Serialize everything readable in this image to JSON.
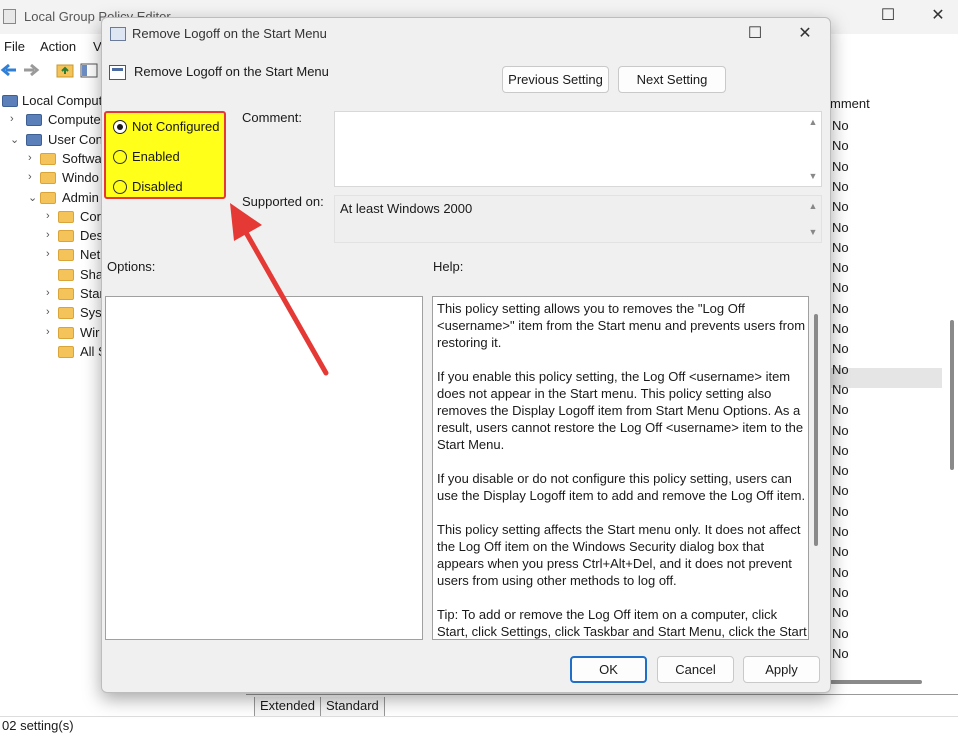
{
  "main": {
    "title": "Local Group Policy Editor",
    "menu": [
      "File",
      "Action",
      "V"
    ],
    "tree": [
      {
        "label": "Local Computer",
        "indent": 0,
        "chev": ""
      },
      {
        "label": "Computer",
        "indent": 1,
        "chev": "›"
      },
      {
        "label": "User Confi",
        "indent": 1,
        "chev": "⌄"
      },
      {
        "label": "Softwa",
        "indent": 2,
        "chev": "›"
      },
      {
        "label": "Windo",
        "indent": 2,
        "chev": "›"
      },
      {
        "label": "Admin",
        "indent": 2,
        "chev": "⌄"
      },
      {
        "label": "Cor",
        "indent": 3,
        "chev": "›"
      },
      {
        "label": "Des",
        "indent": 3,
        "chev": "›"
      },
      {
        "label": "Net",
        "indent": 3,
        "chev": "›"
      },
      {
        "label": "Sha",
        "indent": 3,
        "chev": ""
      },
      {
        "label": "Star",
        "indent": 3,
        "chev": "›"
      },
      {
        "label": "Sys",
        "indent": 3,
        "chev": "›"
      },
      {
        "label": "Wir",
        "indent": 3,
        "chev": "›"
      },
      {
        "label": "All S",
        "indent": 3,
        "chev": ""
      }
    ],
    "right_column_header": "mment",
    "right_column_values": [
      "No",
      "No",
      "No",
      "No",
      "No",
      "No",
      "No",
      "No",
      "No",
      "No",
      "No",
      "No",
      "No",
      "No",
      "No",
      "No",
      "No",
      "No",
      "No",
      "No",
      "No",
      "No",
      "No",
      "No",
      "No",
      "No",
      "No"
    ],
    "tabs": [
      "Extended",
      "Standard"
    ],
    "status": "02 setting(s)"
  },
  "dialog": {
    "title": "Remove Logoff on the Start Menu",
    "setting_name": "Remove Logoff on the Start Menu",
    "prev_button": "Previous Setting",
    "next_button": "Next Setting",
    "radio_options": [
      {
        "label": "Not Configured",
        "checked": true
      },
      {
        "label": "Enabled",
        "checked": false
      },
      {
        "label": "Disabled",
        "checked": false
      }
    ],
    "comment_label": "Comment:",
    "comment_value": "",
    "supported_label": "Supported on:",
    "supported_value": "At least Windows 2000",
    "options_label": "Options:",
    "help_label": "Help:",
    "help_paragraphs": [
      "This policy setting allows you to removes the \"Log Off <username>\" item from the Start menu and prevents users from restoring it.",
      "If you enable this policy setting, the Log Off <username> item does not appear in the Start menu. This policy setting also removes the Display Logoff item from Start Menu Options. As a result, users cannot restore the Log Off <username> item to the Start Menu.",
      "If you disable or do not configure this policy setting, users can use the Display Logoff item to add and remove the Log Off item.",
      "This policy setting affects the Start menu only. It does not affect the Log Off item on the Windows Security dialog box that appears when you press Ctrl+Alt+Del, and it does not prevent users from using other methods to log off.",
      "Tip: To add or remove the Log Off item on a computer, click Start, click Settings, click Taskbar and Start Menu, click the Start Menu"
    ],
    "ok_button": "OK",
    "cancel_button": "Cancel",
    "apply_button": "Apply"
  },
  "colors": {
    "highlight_fill": "#ffff1a",
    "highlight_border": "#e53935",
    "arrow": "#e53935",
    "ok_border": "#1f6fc9"
  }
}
